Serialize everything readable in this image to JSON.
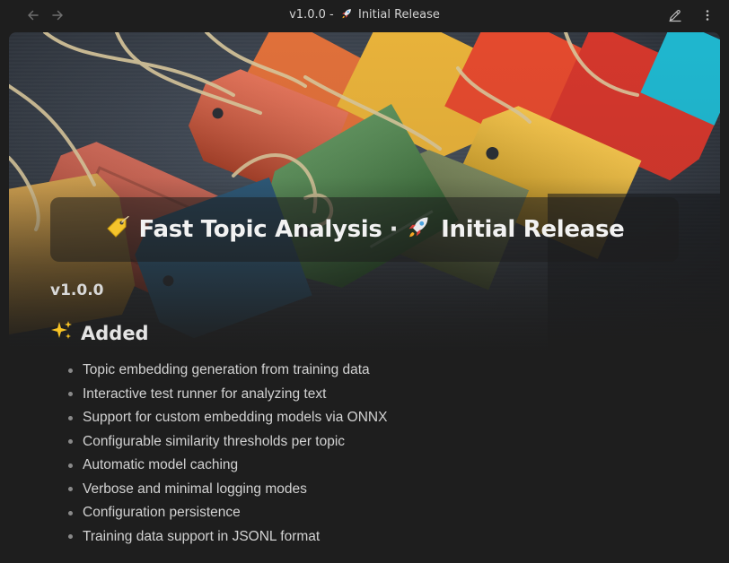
{
  "window": {
    "title_version": "v1.0.0 -",
    "title_name": "Initial Release",
    "icons": {
      "back": "arrow-left-icon",
      "forward": "arrow-right-icon",
      "edit": "pencil-icon",
      "more": "more-vertical-icon",
      "title_emoji": "rocket-icon"
    }
  },
  "doc": {
    "heading_part1": "Fast Topic Analysis",
    "heading_sep": "·",
    "heading_part2": "Initial Release",
    "heading_icons": [
      "tag-icon",
      "rocket-icon"
    ],
    "version": "v1.0.0",
    "section_title": "Added",
    "section_icon": "sparkles-icon",
    "items": [
      "Topic embedding generation from training data",
      "Interactive test runner for analyzing text",
      "Support for custom embedding models via ONNX",
      "Configurable similarity thresholds per topic",
      "Automatic model caching",
      "Verbose and minimal logging modes",
      "Configuration persistence",
      "Training data support in JSONL format"
    ]
  },
  "colors": {
    "background": "#1e1e1e",
    "text": "#d2d2d2",
    "heading": "#f2f2f2"
  }
}
